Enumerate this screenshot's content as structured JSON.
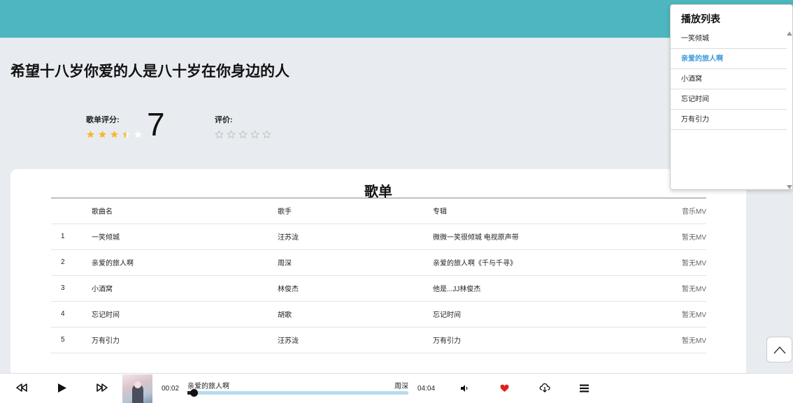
{
  "page": {
    "title": "希望十八岁你爱的人是八十岁在你身边的人"
  },
  "rating": {
    "label": "歌单评分:",
    "score_text": "7",
    "stars_value": 3.5,
    "stars_max": 5
  },
  "review": {
    "label": "评价:",
    "stars_value": 0,
    "stars_max": 5
  },
  "songlist": {
    "title": "歌单",
    "columns": [
      "",
      "歌曲名",
      "歌手",
      "专辑",
      "音乐MV"
    ],
    "rows": [
      {
        "idx": "1",
        "name": "一笑倾城",
        "artist": "汪苏泷",
        "album": "微微一笑很倾城 电视原声带",
        "mv": "暂无MV"
      },
      {
        "idx": "2",
        "name": "亲爱的旅人啊",
        "artist": "周深",
        "album": "亲爱的旅人啊《千与千寻》",
        "mv": "暂无MV"
      },
      {
        "idx": "3",
        "name": "小酒窝",
        "artist": "林俊杰",
        "album": "他是...JJ林俊杰",
        "mv": "暂无MV"
      },
      {
        "idx": "4",
        "name": "忘记时间",
        "artist": "胡歌",
        "album": "忘记时间",
        "mv": "暂无MV"
      },
      {
        "idx": "5",
        "name": "万有引力",
        "artist": "汪苏泷",
        "album": "万有引力",
        "mv": "暂无MV"
      }
    ]
  },
  "playlist": {
    "title": "播放列表",
    "items": [
      {
        "label": "一笑倾城",
        "active": false
      },
      {
        "label": "亲爱的旅人啊",
        "active": true
      },
      {
        "label": "小酒窝",
        "active": false
      },
      {
        "label": "忘记时间",
        "active": false
      },
      {
        "label": "万有引力",
        "active": false
      }
    ]
  },
  "player": {
    "current_time": "00:02",
    "total_time": "04:04",
    "song": "亲爱的旅人啊",
    "artist": "周深",
    "progress_fraction": 0.03,
    "like_color": "#e02020"
  },
  "icons": {
    "prev": "previous-icon",
    "play": "play-icon",
    "next": "next-icon",
    "volume": "volume-icon",
    "like": "heart-icon",
    "download": "download-icon",
    "playlist": "playlist-icon",
    "backtop": "chevron-up-icon"
  },
  "colors": {
    "header": "#4db6be",
    "star_filled": "#f5b82e",
    "star_empty": "#cccccc",
    "active_item": "#3a9ad9"
  }
}
